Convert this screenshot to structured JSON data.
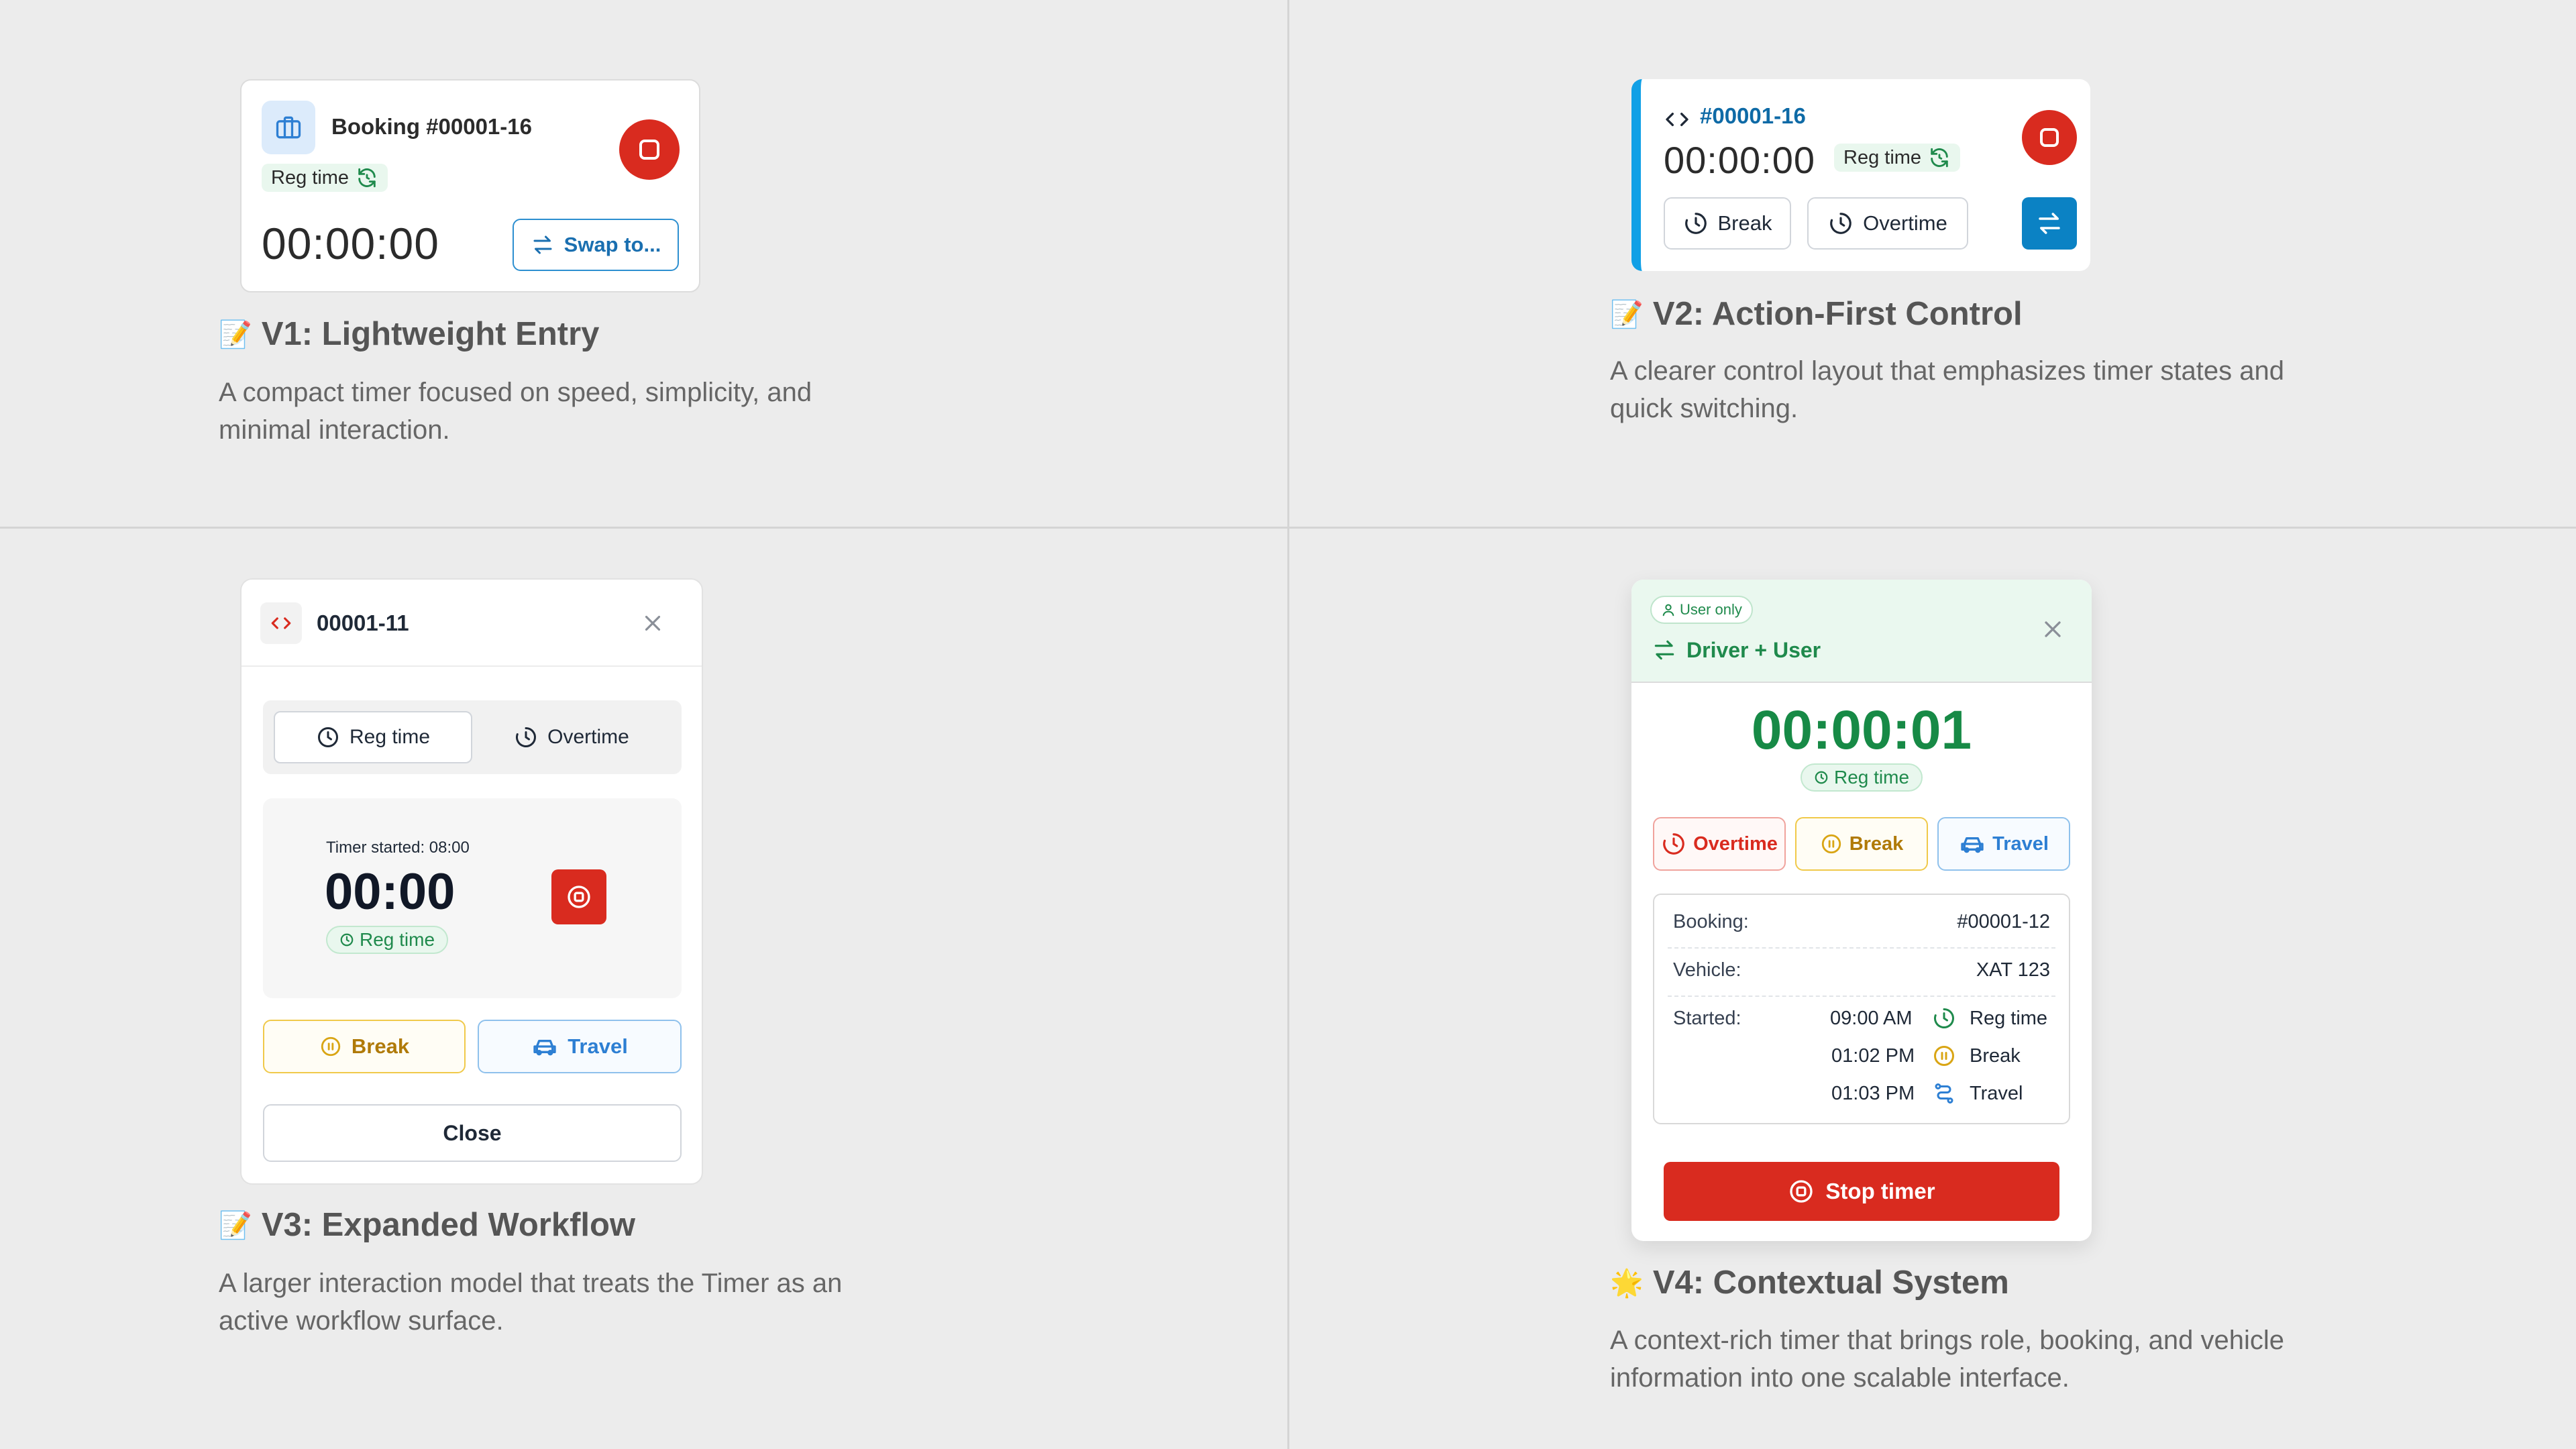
{
  "v1": {
    "booking_title": "Booking #00001-16",
    "mode": "Reg time",
    "timer": "00:00:00",
    "swap_label": "Swap to...",
    "caption_emoji": "📝",
    "caption_title": "V1: Lightweight Entry",
    "caption_desc": "A compact timer focused on speed, simplicity, and minimal interaction."
  },
  "v2": {
    "booking_id": "#00001-16",
    "timer": "00:00:00",
    "mode": "Reg time",
    "break_label": "Break",
    "overtime_label": "Overtime",
    "caption_emoji": "📝",
    "caption_title": "V2: Action-First Control",
    "caption_desc": "A clearer control layout that emphasizes timer states and quick switching."
  },
  "v3": {
    "booking_id": "00001-11",
    "tabs": [
      {
        "label": "Reg time"
      },
      {
        "label": "Overtime"
      }
    ],
    "started_text": "Timer started: 08:00",
    "timer": "00:00",
    "mode": "Reg time",
    "break_label": "Break",
    "travel_label": "Travel",
    "close_label": "Close",
    "caption_emoji": "📝",
    "caption_title": "V3: Expanded Workflow",
    "caption_desc": "A larger interaction model that treats the Timer as an active workflow surface."
  },
  "v4": {
    "role_badge": "User only",
    "role_title": "Driver + User",
    "timer": "00:00:01",
    "mode": "Reg time",
    "overtime_label": "Overtime",
    "break_label": "Break",
    "travel_label": "Travel",
    "booking_label": "Booking:",
    "booking_value": "#00001-12",
    "vehicle_label": "Vehicle:",
    "vehicle_value": "XAT 123",
    "started_label": "Started:",
    "events": [
      {
        "time": "09:00 AM",
        "label": "Reg time",
        "icon": "clock-icon"
      },
      {
        "time": "01:02 PM",
        "label": "Break",
        "icon": "pause-icon"
      },
      {
        "time": "01:03 PM",
        "label": "Travel",
        "icon": "route-icon"
      }
    ],
    "stop_label": "Stop timer",
    "caption_emoji": "🌟",
    "caption_title": "V4: Contextual System",
    "caption_desc": "A context-rich timer that brings role, booking, and vehicle information into one scalable interface."
  },
  "colors": {
    "red": "#d92b1f",
    "green": "#1f8a4c",
    "blue": "#0b82c4",
    "amber": "#c28a10",
    "travel_blue": "#2d7fd3"
  }
}
